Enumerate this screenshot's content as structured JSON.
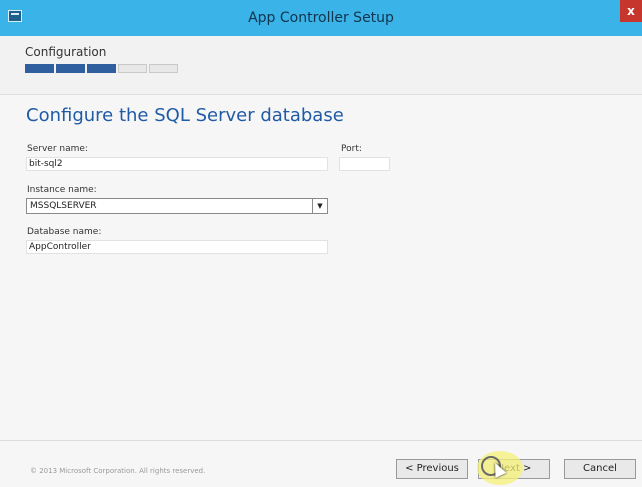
{
  "window": {
    "title": "App Controller Setup",
    "close_label": "x"
  },
  "header": {
    "step_title": "Configuration",
    "progress": {
      "completed_steps": 3,
      "total_steps": 5
    }
  },
  "page": {
    "heading": "Configure the SQL Server database",
    "server_name": {
      "label": "Server name:",
      "value": "bit-sql2"
    },
    "port": {
      "label": "Port:",
      "value": ""
    },
    "instance_name": {
      "label": "Instance name:",
      "value": "MSSQLSERVER"
    },
    "database_name": {
      "label": "Database name:",
      "value": "AppController"
    }
  },
  "footer": {
    "copyright": "© 2013 Microsoft Corporation. All rights reserved.",
    "previous_label": "< Previous",
    "next_label": "Next >",
    "cancel_label": "Cancel"
  },
  "colors": {
    "titlebar": "#39b3e8",
    "heading": "#1f5aa6",
    "progress_done": "#2f5f9f"
  }
}
